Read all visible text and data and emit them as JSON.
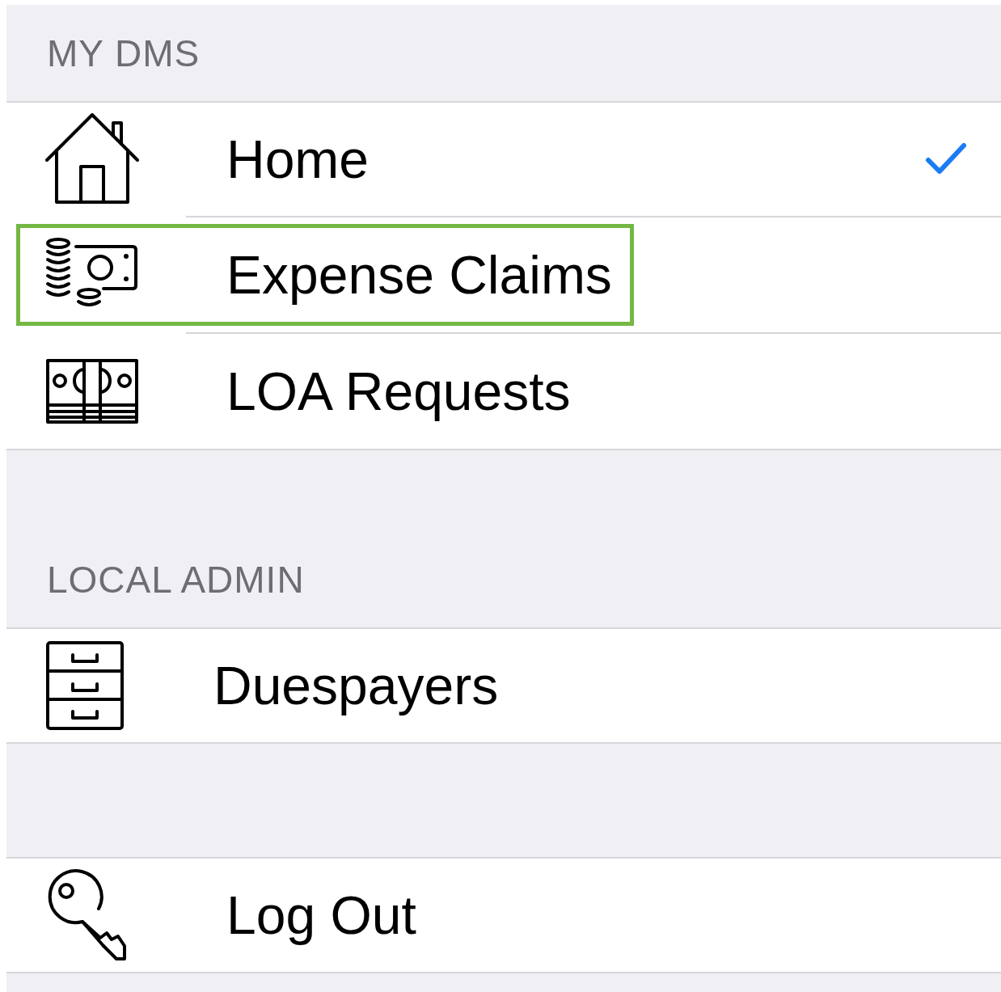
{
  "sections": [
    {
      "header": "MY DMS",
      "items": [
        {
          "label": "Home",
          "selected": true,
          "highlighted": false
        },
        {
          "label": "Expense Claims",
          "selected": false,
          "highlighted": true
        },
        {
          "label": "LOA Requests",
          "selected": false,
          "highlighted": false
        }
      ]
    },
    {
      "header": "LOCAL ADMIN",
      "items": [
        {
          "label": "Duespayers",
          "selected": false,
          "highlighted": false
        }
      ]
    },
    {
      "items": [
        {
          "label": "Log Out",
          "selected": false,
          "highlighted": false
        }
      ]
    }
  ]
}
